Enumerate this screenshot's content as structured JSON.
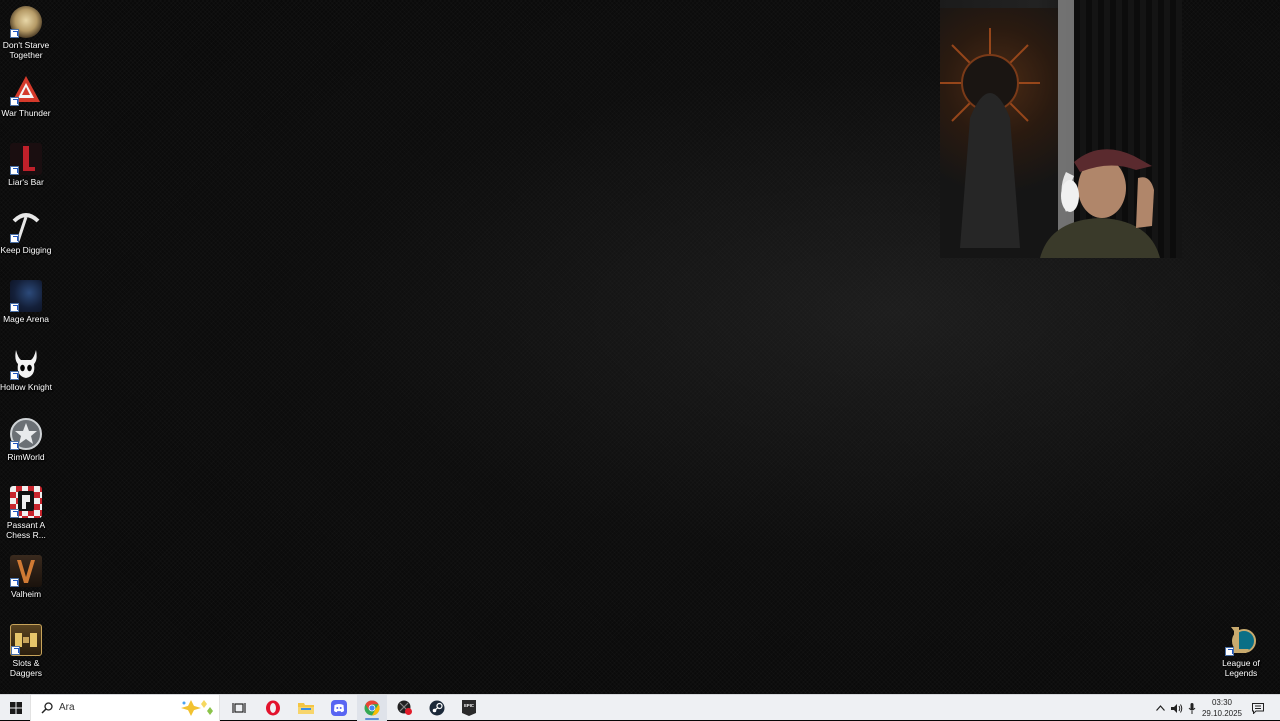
{
  "desktop": {
    "icons_left": [
      {
        "label": "Don't Starve Together",
        "icon": "dont-starve-together-icon",
        "color": "#c9b58a"
      },
      {
        "label": "War Thunder",
        "icon": "war-thunder-icon",
        "color": "#d53a2b"
      },
      {
        "label": "Liar's Bar",
        "icon": "liars-bar-icon",
        "color": "#c0202a"
      },
      {
        "label": "Keep Digging",
        "icon": "keep-digging-icon",
        "color": "#e8e8e8"
      },
      {
        "label": "Mage Arena",
        "icon": "mage-arena-icon",
        "color": "#1a2a4a"
      },
      {
        "label": "Hollow Knight",
        "icon": "hollow-knight-icon",
        "color": "#f2f2f2"
      },
      {
        "label": "RimWorld",
        "icon": "rimworld-icon",
        "color": "#9aa0a6"
      },
      {
        "label": "Passant A Chess R...",
        "icon": "passant-chess-icon",
        "color": "#c8242c"
      },
      {
        "label": "Valheim",
        "icon": "valheim-icon",
        "color": "#b46a2e"
      },
      {
        "label": "Slots & Daggers",
        "icon": "slots-daggers-icon",
        "color": "#c8a45a"
      }
    ],
    "icons_right": [
      {
        "label": "League of Legends",
        "icon": "league-of-legends-icon",
        "color": "#c8aa6e"
      }
    ]
  },
  "webcam": {
    "icon": "webcam-feed"
  },
  "taskbar": {
    "start_icon": "windows-start-icon",
    "search": {
      "placeholder": "Ara"
    },
    "pinned": [
      {
        "icon": "task-view-icon"
      },
      {
        "icon": "opera-icon",
        "color": "#e3132d"
      },
      {
        "icon": "file-explorer-icon",
        "color": "#f4c542"
      },
      {
        "icon": "discord-icon",
        "color": "#5865f2"
      },
      {
        "icon": "chrome-icon",
        "active": true
      },
      {
        "icon": "app-red-icon"
      },
      {
        "icon": "steam-icon",
        "color": "#1b2838"
      },
      {
        "icon": "epic-games-icon",
        "color": "#2a2a2a"
      }
    ],
    "tray": {
      "time": "03:30",
      "date": "29.10.2025"
    }
  }
}
